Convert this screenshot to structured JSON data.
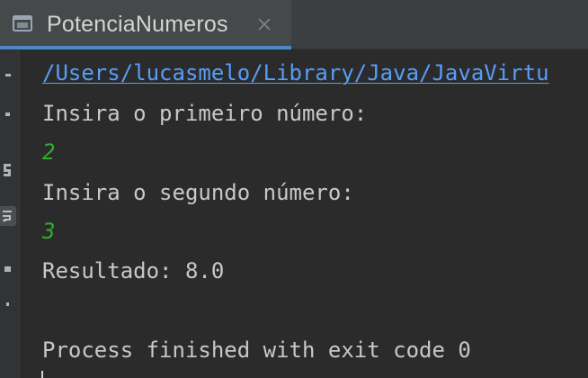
{
  "tab": {
    "title": "PotenciaNumeros",
    "icon": "console-window-icon",
    "close_icon": "close-icon"
  },
  "colors": {
    "background": "#2b2b2b",
    "tab_active_underline": "#4a88c7",
    "link": "#589df6",
    "user_input": "#2fae2f",
    "text": "#c8c8c8"
  },
  "console": {
    "lines": [
      "/Users/lucasmelo/Library/Java/JavaVirtu",
      "Insira o primeiro número:",
      "2",
      "Insira o segundo número:",
      "3",
      "Resultado: 8.0",
      "",
      "Process finished with exit code 0"
    ]
  },
  "gutter": {
    "icons": [
      "rerun-icon",
      "stop-icon",
      "restore-layout-icon",
      "soft-wrap-icon",
      "print-icon",
      "pin-icon"
    ]
  }
}
